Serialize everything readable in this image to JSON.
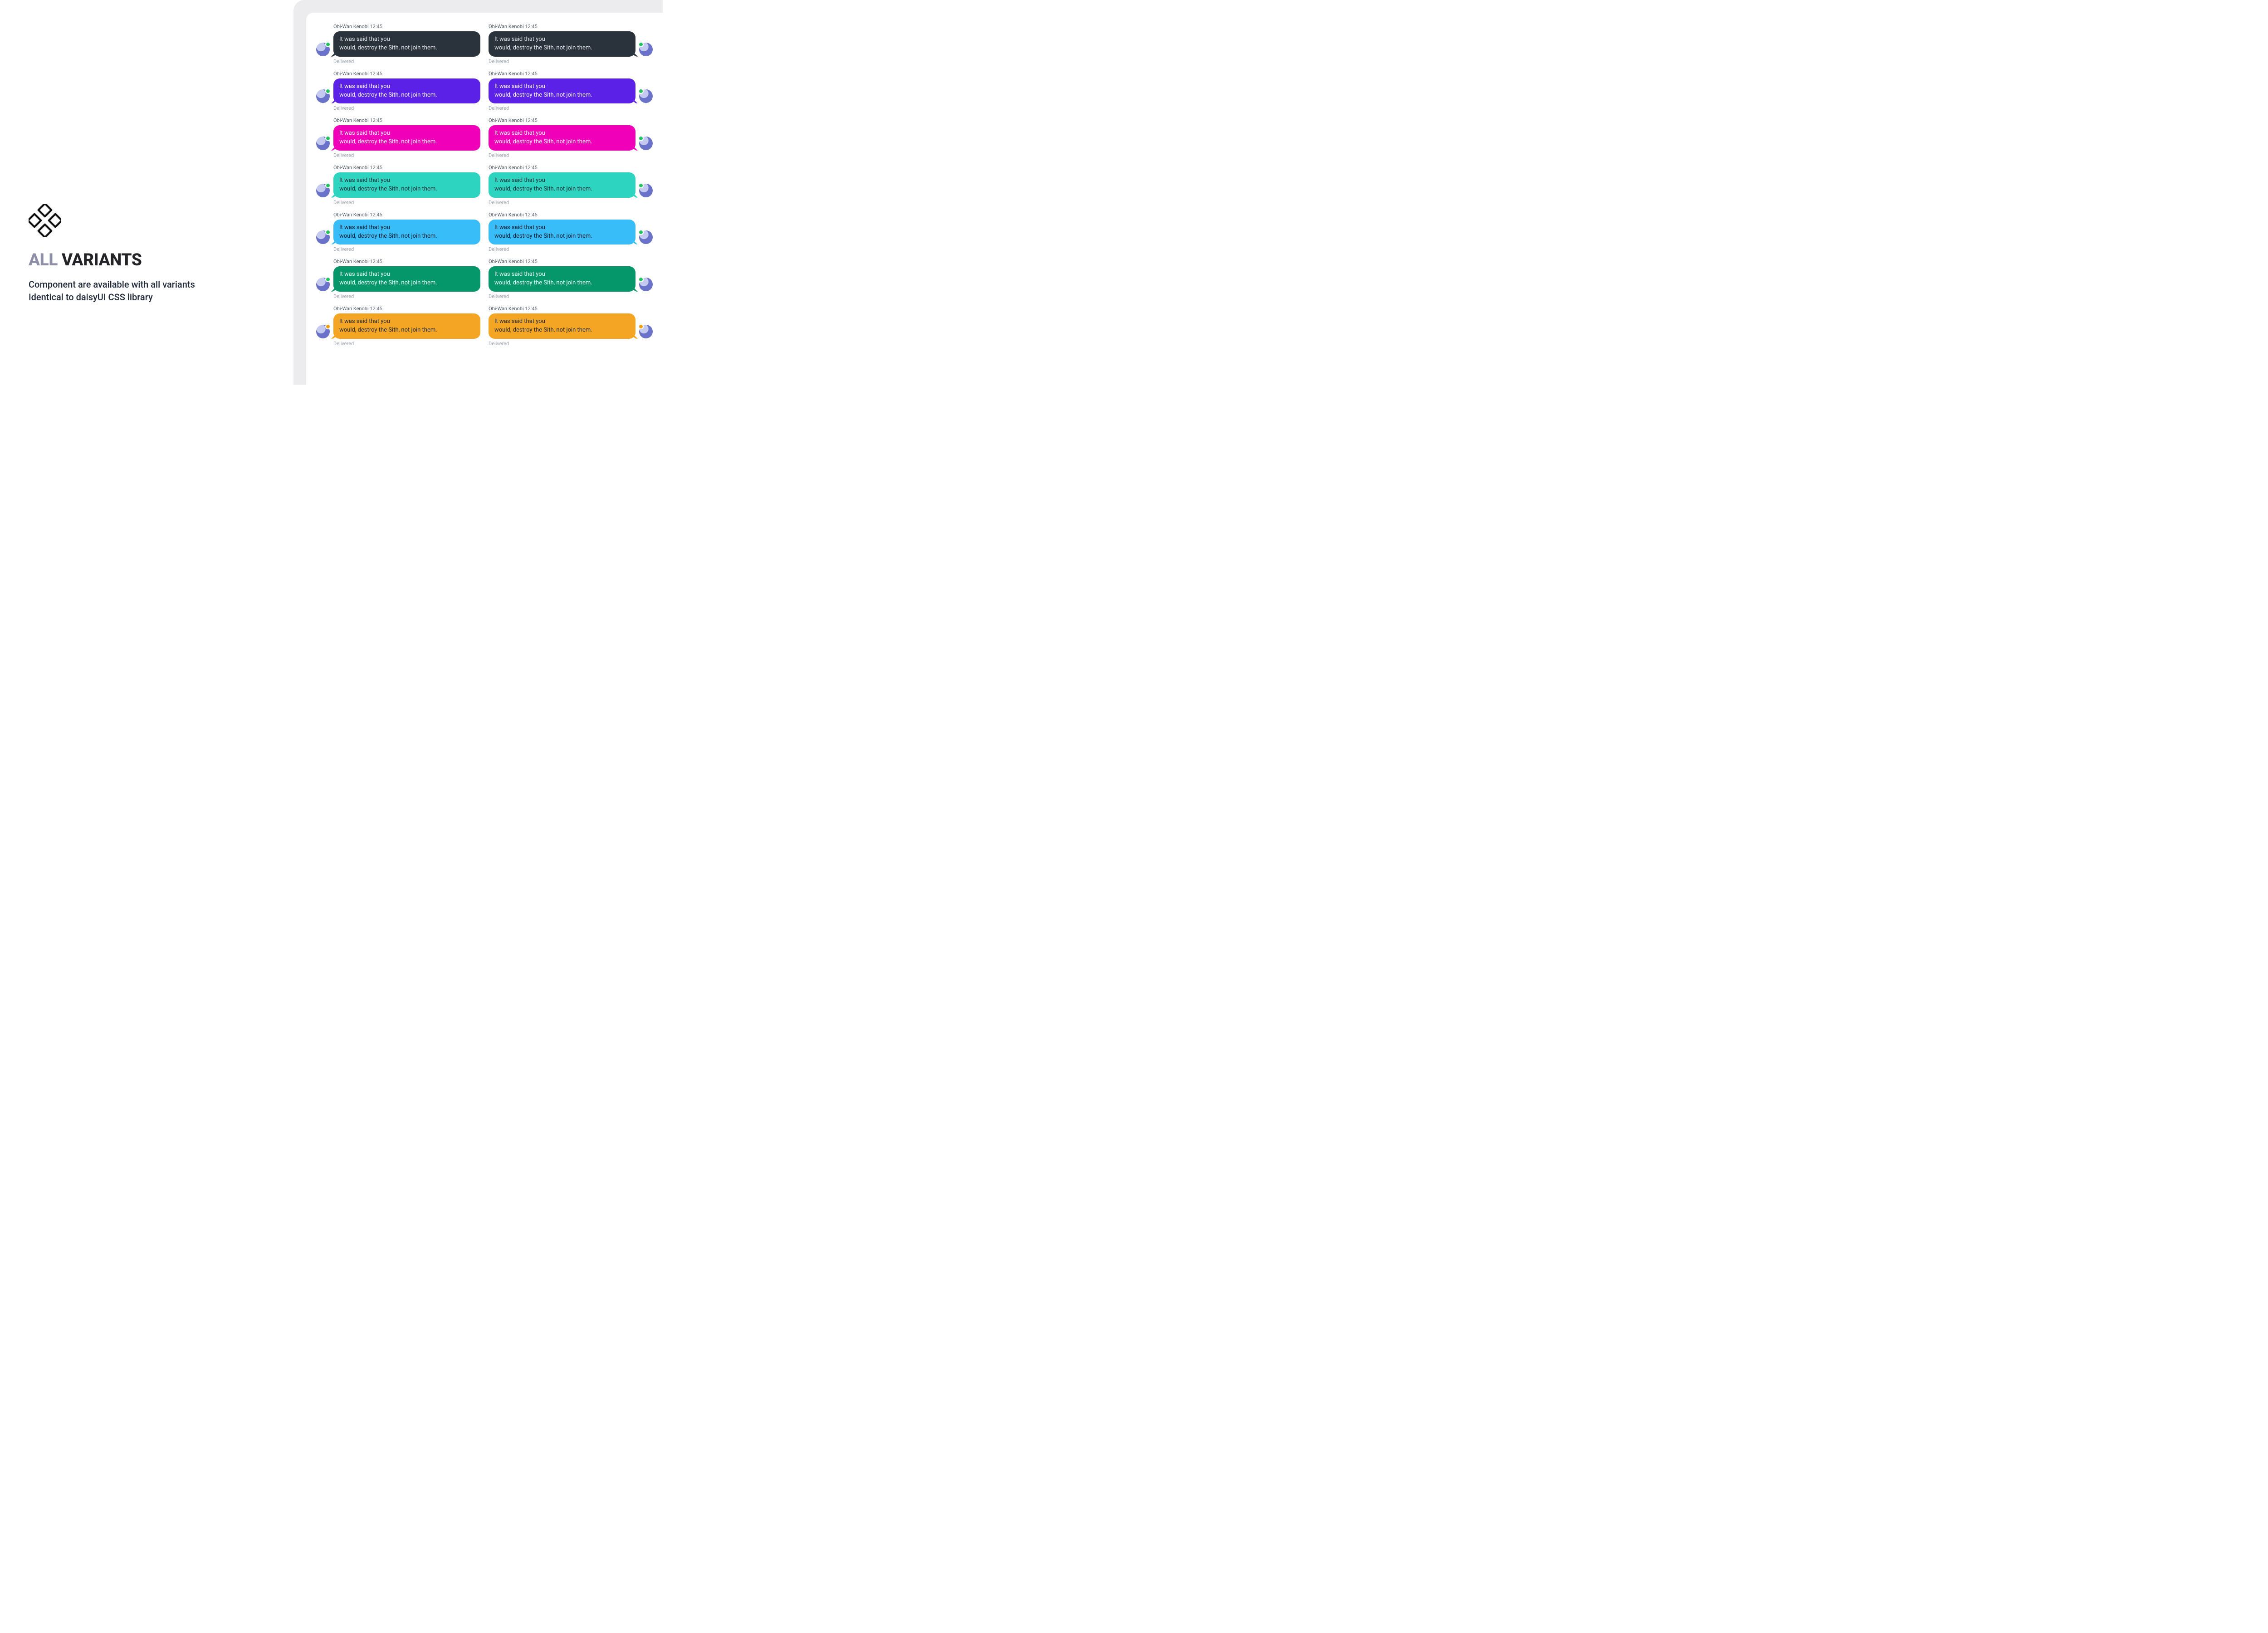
{
  "left": {
    "title_gray": "ALL ",
    "title_dark": "VARIANTS",
    "subtitle_l1": "Component are available with all variants",
    "subtitle_l2": "Identical to daisyUI CSS library"
  },
  "common": {
    "author": "Obi-Wan Kenobi",
    "time": "12:45",
    "line1": "It was said that you",
    "line2": "would, destroy the Sith, not join them.",
    "status": "Delivered"
  },
  "variants": [
    {
      "name": "neutral",
      "class": "c-neutral",
      "dot": "green"
    },
    {
      "name": "primary",
      "class": "c-primary",
      "dot": "green"
    },
    {
      "name": "secondary",
      "class": "c-secondary",
      "dot": "green"
    },
    {
      "name": "accent",
      "class": "c-accent",
      "dot": "green"
    },
    {
      "name": "info",
      "class": "c-info",
      "dot": "green"
    },
    {
      "name": "success",
      "class": "c-success",
      "dot": "green"
    },
    {
      "name": "warning",
      "class": "c-warning",
      "dot": "yellow"
    }
  ],
  "colors": {
    "accent_gray_title": "#8e8fa7",
    "neutral": "#2a323c",
    "primary": "#5b21e6",
    "secondary": "#f000b8",
    "accent": "#2dd4bf",
    "info": "#38bdf8",
    "success": "#059669",
    "warning": "#f5a524"
  }
}
